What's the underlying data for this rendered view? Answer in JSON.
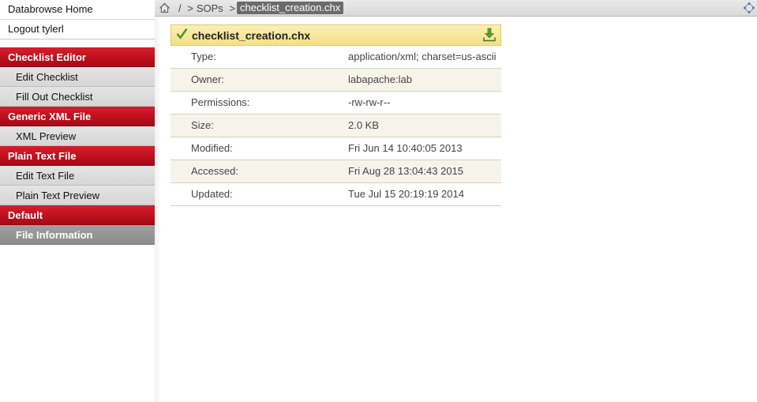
{
  "sidebar": {
    "top_links": [
      {
        "label": "Databrowse Home"
      },
      {
        "label": "Logout tylerl"
      }
    ],
    "sections": [
      {
        "title": "Checklist Editor",
        "items": [
          {
            "label": "Edit Checklist"
          },
          {
            "label": "Fill Out Checklist"
          }
        ]
      },
      {
        "title": "Generic XML File",
        "items": [
          {
            "label": "XML Preview"
          }
        ]
      },
      {
        "title": "Plain Text File",
        "items": [
          {
            "label": "Edit Text File"
          },
          {
            "label": "Plain Text Preview"
          }
        ]
      },
      {
        "title": "Default",
        "items": [
          {
            "label": "File Information",
            "active": true
          }
        ]
      }
    ]
  },
  "breadcrumb": {
    "home_icon": "home-icon",
    "root": "/",
    "separator": ">",
    "folder": "SOPs",
    "current": "checklist_creation.chx",
    "move_icon": "move-arrows-icon"
  },
  "file_info": {
    "title": "checklist_creation.chx",
    "status_icon": "check-icon",
    "download_icon": "download-icon",
    "rows": [
      {
        "key": "Type:",
        "value": "application/xml; charset=us-ascii"
      },
      {
        "key": "Owner:",
        "value": "labapache:lab"
      },
      {
        "key": "Permissions:",
        "value": "-rw-rw-r--"
      },
      {
        "key": "Size:",
        "value": "2.0 KB"
      },
      {
        "key": "Modified:",
        "value": "Fri Jun 14 10:40:05 2013"
      },
      {
        "key": "Accessed:",
        "value": "Fri Aug 28 13:04:43 2015"
      },
      {
        "key": "Updated:",
        "value": "Tue Jul 15 20:19:19 2014"
      }
    ]
  },
  "colors": {
    "section_header": "#c0101d",
    "panel_header": "#f5df86",
    "active_item": "#8c8c8c"
  }
}
